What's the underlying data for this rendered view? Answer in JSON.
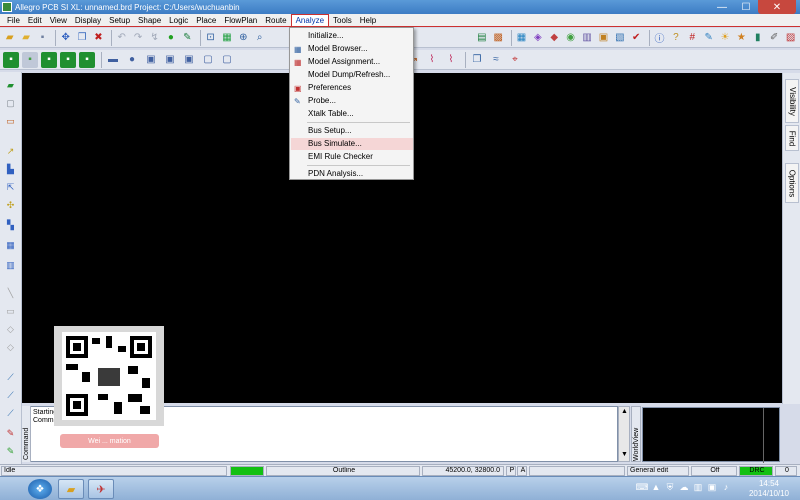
{
  "window": {
    "title": "Allegro PCB SI XL: unnamed.brd  Project: C:/Users/wuchuanbin",
    "minimize": "—",
    "maximize": "☐",
    "close": "✕"
  },
  "menu": [
    {
      "label": "File"
    },
    {
      "label": "Edit"
    },
    {
      "label": "View"
    },
    {
      "label": "Display"
    },
    {
      "label": "Setup"
    },
    {
      "label": "Shape"
    },
    {
      "label": "Logic"
    },
    {
      "label": "Place"
    },
    {
      "label": "FlowPlan"
    },
    {
      "label": "Route"
    },
    {
      "label": "Analyze"
    },
    {
      "label": "Tools"
    },
    {
      "label": "Help"
    }
  ],
  "analyze_menu": {
    "group1": [
      "Initialize...",
      "Model Browser...",
      "Model Assignment...",
      "Model Dump/Refresh...",
      "Preferences",
      "Probe...",
      "Xtalk Table..."
    ],
    "group2": [
      "Bus Setup...",
      "Bus Simulate...",
      "EMI Rule Checker"
    ],
    "group3": [
      "PDN Analysis..."
    ],
    "highlighted": "Bus Simulate..."
  },
  "right_tabs": [
    "Visibility",
    "Find",
    "Options"
  ],
  "command_window": {
    "label": "Command",
    "line1": "Starting ",
    "line2": "Command"
  },
  "worldview_label": "WorldView",
  "overlay_button": "Wei ... mation",
  "status": {
    "left": "Idle",
    "mode": "Outline",
    "coords": "45200.0, 32800.0",
    "p": "P",
    "a": "A",
    "edit": "General edit",
    "off": "Off",
    "drc": "DRC",
    "zero": "0"
  },
  "taskbar": {
    "time": "14:54",
    "date": "2014/10/10"
  },
  "colors": {
    "canvas": "#000000",
    "highlight": "#f5d6d6",
    "status_green": "#12c012",
    "active_menu_border": "#cc3030"
  }
}
